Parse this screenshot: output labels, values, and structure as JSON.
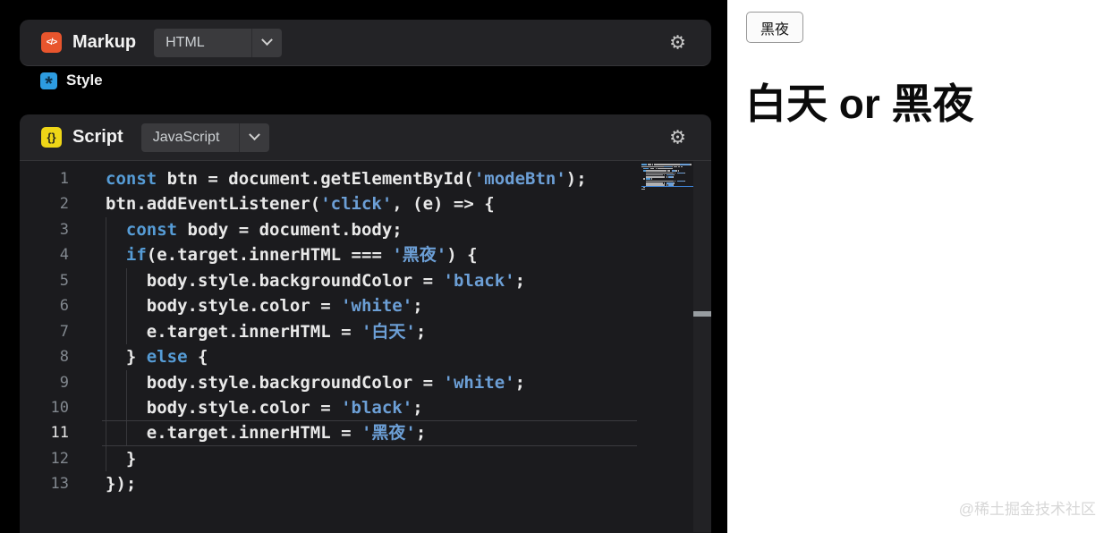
{
  "panels": {
    "markup": {
      "title": "Markup",
      "language": "HTML",
      "icon_glyph": "</>"
    },
    "style": {
      "title": "Style",
      "icon_glyph": "*"
    },
    "script": {
      "title": "Script",
      "language": "JavaScript",
      "icon_glyph": "{}"
    }
  },
  "icons": {
    "settings_glyph": "⚙"
  },
  "editor": {
    "active_line": 11,
    "lines": [
      {
        "tokens": [
          [
            "kw",
            "const"
          ],
          [
            "pl",
            " btn = document.getElementById("
          ],
          [
            "str",
            "'modeBtn'"
          ],
          [
            "pl",
            ");"
          ]
        ]
      },
      {
        "tokens": [
          [
            "pl",
            "btn.addEventListener("
          ],
          [
            "str",
            "'click'"
          ],
          [
            "pl",
            ", (e) => {"
          ]
        ]
      },
      {
        "tokens": [
          [
            "pl",
            "  "
          ],
          [
            "kw",
            "const"
          ],
          [
            "pl",
            " body = document.body;"
          ]
        ]
      },
      {
        "tokens": [
          [
            "pl",
            "  "
          ],
          [
            "kw",
            "if"
          ],
          [
            "pl",
            "(e.target.innerHTML === "
          ],
          [
            "str",
            "'黑夜'"
          ],
          [
            "pl",
            ") {"
          ]
        ]
      },
      {
        "tokens": [
          [
            "pl",
            "    body.style.backgroundColor = "
          ],
          [
            "str",
            "'black'"
          ],
          [
            "pl",
            ";"
          ]
        ]
      },
      {
        "tokens": [
          [
            "pl",
            "    body.style.color = "
          ],
          [
            "str",
            "'white'"
          ],
          [
            "pl",
            ";"
          ]
        ]
      },
      {
        "tokens": [
          [
            "pl",
            "    e.target.innerHTML = "
          ],
          [
            "str",
            "'白天'"
          ],
          [
            "pl",
            ";"
          ]
        ]
      },
      {
        "tokens": [
          [
            "pl",
            "  } "
          ],
          [
            "kw",
            "else"
          ],
          [
            "pl",
            " {"
          ]
        ]
      },
      {
        "tokens": [
          [
            "pl",
            "    body.style.backgroundColor = "
          ],
          [
            "str",
            "'white'"
          ],
          [
            "pl",
            ";"
          ]
        ]
      },
      {
        "tokens": [
          [
            "pl",
            "    body.style.color = "
          ],
          [
            "str",
            "'black'"
          ],
          [
            "pl",
            ";"
          ]
        ]
      },
      {
        "tokens": [
          [
            "pl",
            "    e.target.innerHTML = "
          ],
          [
            "str",
            "'黑夜'"
          ],
          [
            "pl",
            ";"
          ]
        ]
      },
      {
        "tokens": [
          [
            "pl",
            "  }"
          ]
        ]
      },
      {
        "tokens": [
          [
            "pl",
            "});"
          ]
        ]
      }
    ]
  },
  "preview": {
    "button_label": "黑夜",
    "heading": "白天 or 黑夜",
    "watermark": "@稀土掘金技术社区"
  },
  "colors": {
    "markup_accent": "#e8552d",
    "style_accent": "#2d9ce0",
    "script_accent": "#efd617",
    "keyword": "#569cd6",
    "string": "#6c9fd6",
    "editor_bg": "#1b1b1e",
    "bar_bg": "#232326"
  }
}
